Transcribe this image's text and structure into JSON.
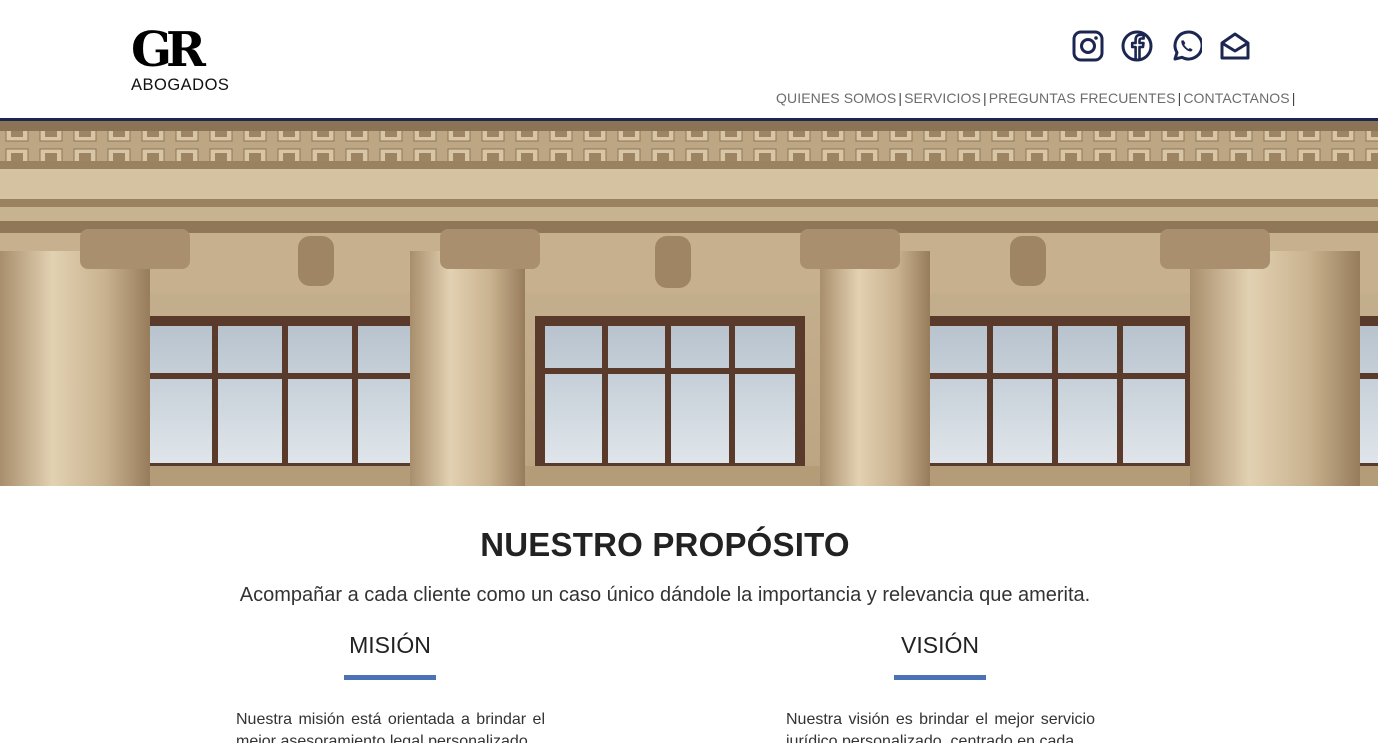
{
  "header": {
    "logo_mark": "GR",
    "logo_sub": "ABOGADOS",
    "socials": [
      {
        "icon": "instagram-icon"
      },
      {
        "icon": "facebook-icon"
      },
      {
        "icon": "whatsapp-icon"
      },
      {
        "icon": "mail-icon"
      }
    ],
    "nav": {
      "items": [
        "QUIENES SOMOS",
        "SERVICIOS",
        "PREGUNTAS FRECUENTES",
        "CONTACTANOS"
      ],
      "separator": "|"
    }
  },
  "colors": {
    "header_line": "#1c2751",
    "accent_bar": "#4b72b5",
    "nav_text": "#6c6c6c",
    "icon": "#1c2751"
  },
  "purpose": {
    "title": "NUESTRO PROPÓSITO",
    "subtitle": "Acompañar a cada cliente como un caso único dándole la importancia y relevancia que amerita."
  },
  "mission": {
    "title": "MISIÓN",
    "text": "Nuestra misión está orientada a brindar el mejor asesoramiento legal personalizado"
  },
  "vision": {
    "title": "VISIÓN",
    "text": "Nuestra visión es brindar el mejor servicio jurídico personalizado, centrado en cada"
  }
}
